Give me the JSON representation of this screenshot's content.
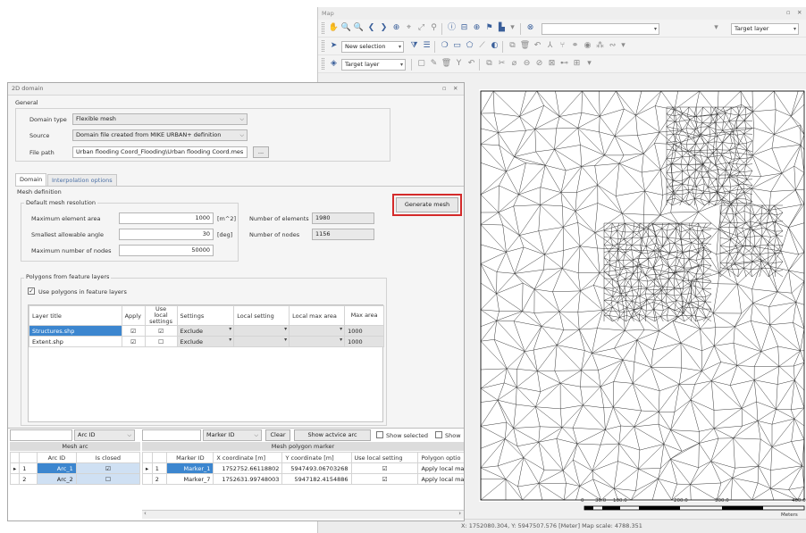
{
  "map": {
    "title": "Map",
    "toolbar1": {
      "dropdown_value": "",
      "target_layer": "Target layer"
    },
    "toolbar2": {
      "selection_mode": "New selection"
    },
    "toolbar3": {
      "target_layer": "Target layer"
    },
    "scalebar": {
      "ticks": [
        "0",
        "30.0",
        "100.0",
        "200.0",
        "300.0",
        "400.0"
      ],
      "unit": "Meters"
    },
    "status": "X: 1752080.304, Y: 5947507.576 [Meter]   Map scale: 4788.351"
  },
  "dialog": {
    "title": "2D domain",
    "general": {
      "title": "General",
      "domain_type_label": "Domain type",
      "domain_type_value": "Flexible mesh",
      "source_label": "Source",
      "source_value": "Domain file created from MIKE URBAN+ definition",
      "file_path_label": "File path",
      "file_path_value": "Urban flooding Coord_Flooding\\Urban flooding Coord.mes",
      "browse_label": "..."
    },
    "tabs": [
      "Domain",
      "Interpolation options"
    ],
    "mesh_definition_title": "Mesh definition",
    "resolution": {
      "title": "Default mesh resolution",
      "max_area_label": "Maximum element area",
      "max_area_value": "1000",
      "max_area_unit": "[m^2]",
      "min_angle_label": "Smallest allowable angle",
      "min_angle_value": "30",
      "min_angle_unit": "[deg]",
      "max_nodes_label": "Maximum number of nodes",
      "max_nodes_value": "50000",
      "num_elements_label": "Number of elements",
      "num_elements_value": "1980",
      "num_nodes_label": "Number of nodes",
      "num_nodes_value": "1156"
    },
    "generate_label": "Generate mesh",
    "polygons": {
      "title": "Polygons from feature layers",
      "use_polygons_label": "Use polygons in feature layers",
      "columns": [
        "Layer title",
        "Apply",
        "Use local settings",
        "Settings",
        "Local setting",
        "Local max area",
        "Max area"
      ],
      "rows": [
        {
          "layer": "Structures.shp",
          "apply": "☑",
          "local": "☑",
          "settings": "Exclude",
          "max_area": "1000"
        },
        {
          "layer": "Extent.shp",
          "apply": "☑",
          "local": "☐",
          "settings": "Exclude",
          "max_area": "1000"
        }
      ]
    },
    "arc_pane": {
      "combo_value": "Arc ID",
      "header": "Mesh arc",
      "columns": [
        "Arc ID",
        "Is closed"
      ],
      "rows": [
        {
          "marker": "▸",
          "num": "1",
          "arc": "Arc_1",
          "closed": "☑"
        },
        {
          "marker": "",
          "num": "2",
          "arc": "Arc_2",
          "closed": "☐"
        }
      ]
    },
    "marker_pane": {
      "combo_value": "Marker ID",
      "clear_label": "Clear",
      "show_active_label": "Show actvice arc",
      "show_selected_label": "Show selected",
      "show_label": "Show",
      "header": "Mesh polygon marker",
      "columns": [
        "Marker ID",
        "X coordinate [m]",
        "Y coordinate [m]",
        "Use local setting",
        "Polygon optio"
      ],
      "rows": [
        {
          "marker": "▸",
          "num": "1",
          "id": "Marker_1",
          "x": "1752752.66118802",
          "y": "5947493.06703268",
          "use": "☑",
          "opt": "Apply local ma"
        },
        {
          "marker": "",
          "num": "2",
          "id": "Marker_7",
          "x": "1752631.99748003",
          "y": "5947182.4154886",
          "use": "☑",
          "opt": "Apply local ma"
        }
      ]
    }
  }
}
